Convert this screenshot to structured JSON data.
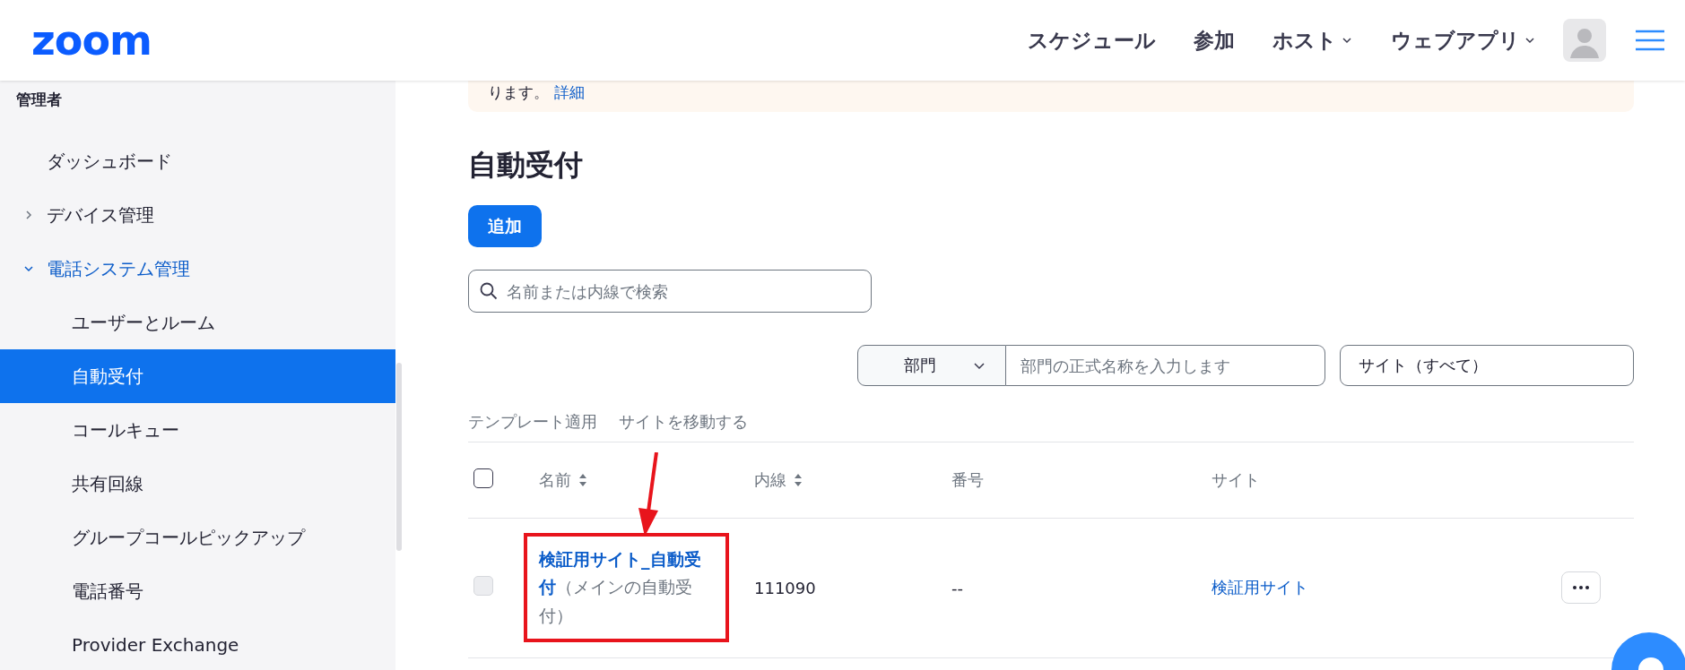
{
  "header": {
    "logo": "zoom",
    "nav": [
      {
        "label": "スケジュール",
        "dropdown": false
      },
      {
        "label": "参加",
        "dropdown": false
      },
      {
        "label": "ホスト",
        "dropdown": true
      },
      {
        "label": "ウェブアプリ",
        "dropdown": true
      }
    ]
  },
  "sidebar": {
    "heading": "管理者",
    "items": [
      {
        "kind": "link",
        "label": "ダッシュボード",
        "selected": false
      },
      {
        "kind": "group",
        "label": "デバイス管理",
        "expanded": false,
        "selected": false
      },
      {
        "kind": "group",
        "label": "電話システム管理",
        "expanded": true,
        "selected": false,
        "children": [
          {
            "label": "ユーザーとルーム",
            "selected": false
          },
          {
            "label": "自動受付",
            "selected": true
          },
          {
            "label": "コールキュー",
            "selected": false
          },
          {
            "label": "共有回線",
            "selected": false
          },
          {
            "label": "グループコールピックアップ",
            "selected": false
          },
          {
            "label": "電話番号",
            "selected": false
          },
          {
            "label": "Provider Exchange",
            "selected": false
          }
        ]
      }
    ]
  },
  "banner": {
    "text": "ります。",
    "link": "詳細"
  },
  "page": {
    "title": "自動受付",
    "add_button": "追加",
    "search": {
      "placeholder": "名前または内線で検索"
    },
    "filters": {
      "department_select": "部門",
      "department_input": {
        "placeholder": "部門の正式名称を入力します"
      },
      "site_select": "サイト（すべて）"
    },
    "actions": [
      "テンプレート適用",
      "サイトを移動する"
    ]
  },
  "table": {
    "header_checkbox": {
      "checked": false
    },
    "columns": [
      {
        "label": "名前",
        "sortable": true
      },
      {
        "label": "内線",
        "sortable": true
      },
      {
        "label": "番号",
        "sortable": false
      },
      {
        "label": "サイト",
        "sortable": false
      }
    ],
    "rows": [
      {
        "checked": false,
        "disabled": true,
        "highlighted": true,
        "name": "検証用サイト_自動受付",
        "note": "（メインの自動受付）",
        "extension": "111090",
        "number": "--",
        "site": "検証用サイト"
      }
    ]
  }
}
